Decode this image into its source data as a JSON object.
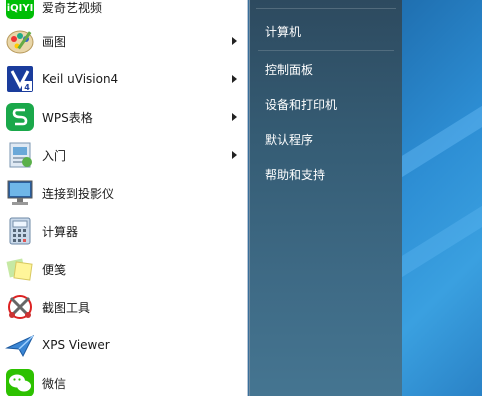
{
  "programs": [
    {
      "label": "爱奇艺视频",
      "icon": "iqiyi-icon",
      "has_submenu": false
    },
    {
      "label": "画图",
      "icon": "paint-icon",
      "has_submenu": true
    },
    {
      "label": "Keil uVision4",
      "icon": "keil-icon",
      "has_submenu": true
    },
    {
      "label": "WPS表格",
      "icon": "wps-spreadsheet-icon",
      "has_submenu": true
    },
    {
      "label": "入门",
      "icon": "getting-started-icon",
      "has_submenu": true
    },
    {
      "label": "连接到投影仪",
      "icon": "projector-icon",
      "has_submenu": false
    },
    {
      "label": "计算器",
      "icon": "calculator-icon",
      "has_submenu": false
    },
    {
      "label": "便笺",
      "icon": "sticky-notes-icon",
      "has_submenu": false
    },
    {
      "label": "截图工具",
      "icon": "snipping-tool-icon",
      "has_submenu": false
    },
    {
      "label": "XPS Viewer",
      "icon": "xps-viewer-icon",
      "has_submenu": false
    },
    {
      "label": "微信",
      "icon": "wechat-icon",
      "has_submenu": false
    }
  ],
  "places": [
    {
      "label": "计算机"
    },
    {
      "label": "控制面板"
    },
    {
      "label": "设备和打印机"
    },
    {
      "label": "默认程序"
    },
    {
      "label": "帮助和支持"
    }
  ],
  "colors": {
    "iqiyi_green": "#00be06",
    "wps_green": "#1aa84a",
    "wechat_green": "#2dc100",
    "keil_blue": "#1a3c9c",
    "right_pane_top": "#2d4a5f",
    "desktop_blue": "#2d8ed4"
  }
}
